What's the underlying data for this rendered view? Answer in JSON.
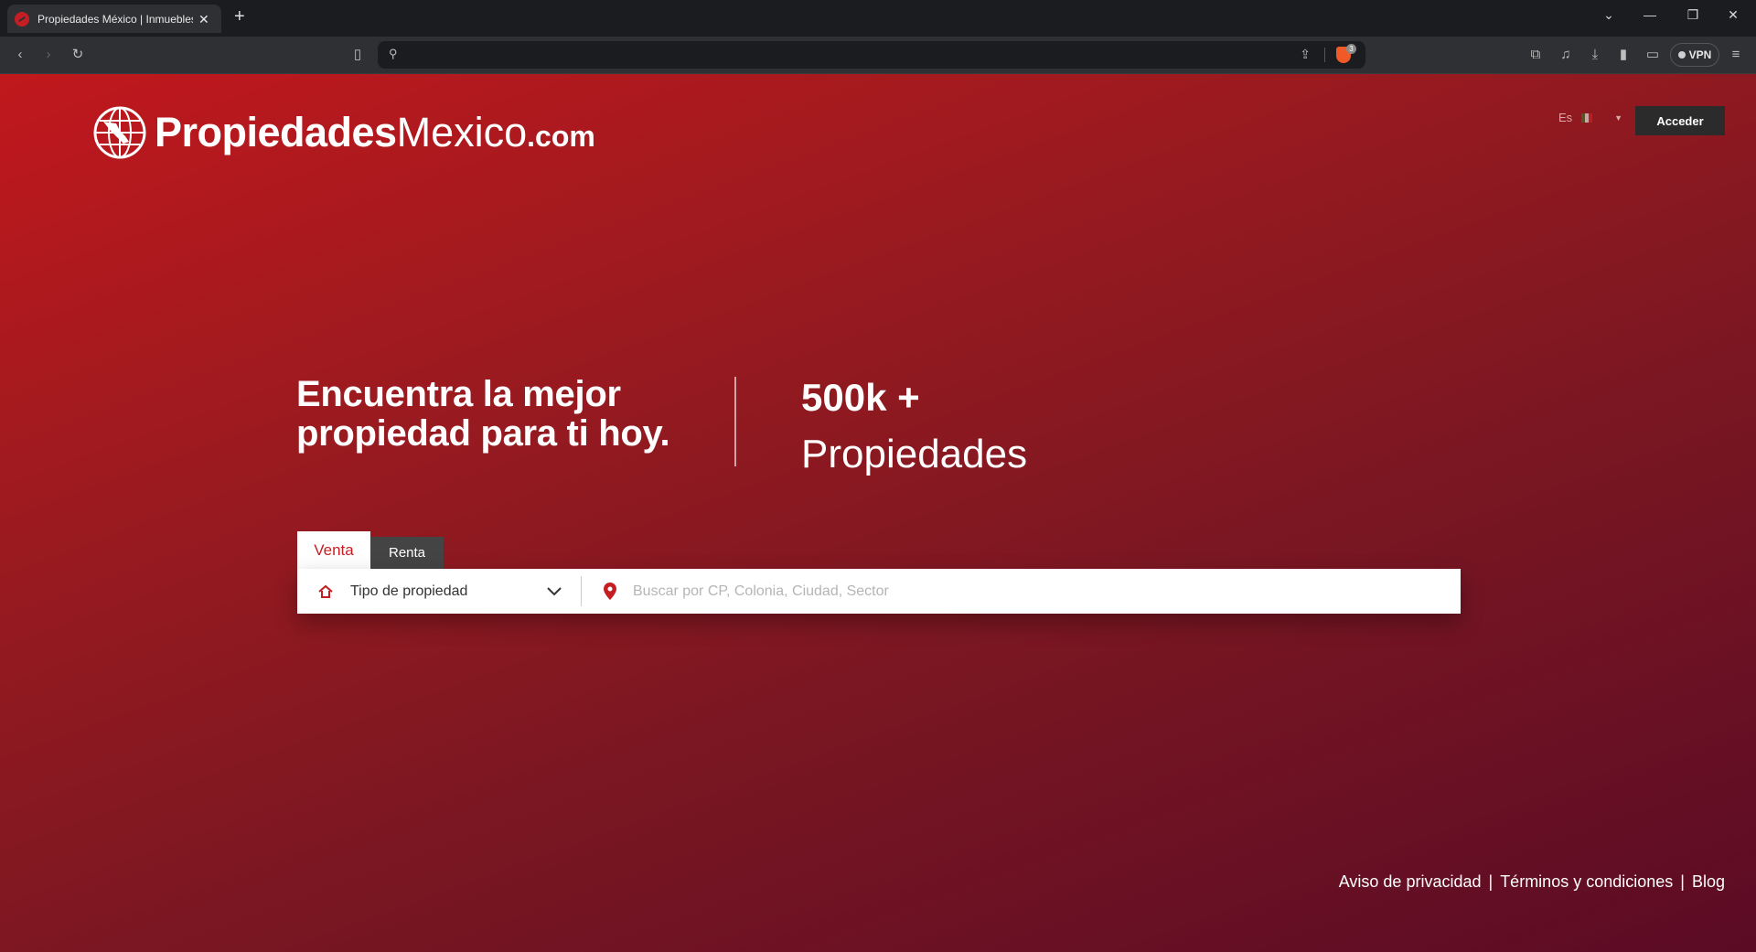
{
  "browser": {
    "tab_title": "Propiedades México | Inmuebles en venta y renta",
    "vpn_label": "VPN",
    "shield_count": "3",
    "address": ""
  },
  "site": {
    "logo": {
      "bold": "Propiedades",
      "light": "Mexico",
      "suffix": ".com"
    },
    "language": "Es",
    "login_label": "Acceder"
  },
  "hero": {
    "headline": "Encuentra la mejor propiedad para ti hoy.",
    "stat_number": "500k +",
    "stat_label": "Propiedades"
  },
  "search": {
    "tabs": [
      {
        "label": "Venta",
        "active": true
      },
      {
        "label": "Renta",
        "active": false
      }
    ],
    "type_select": "Tipo de propiedad",
    "placeholder": "Buscar por CP, Colonia, Ciudad, Sector",
    "value": ""
  },
  "footer": {
    "links": [
      "Aviso de privacidad",
      "Términos y condiciones",
      "Blog"
    ]
  },
  "colors": {
    "brand_red": "#c41e24",
    "gradient_start": "#c0181d",
    "gradient_end": "#5b0b25",
    "login_bg": "#2b2b2b"
  }
}
